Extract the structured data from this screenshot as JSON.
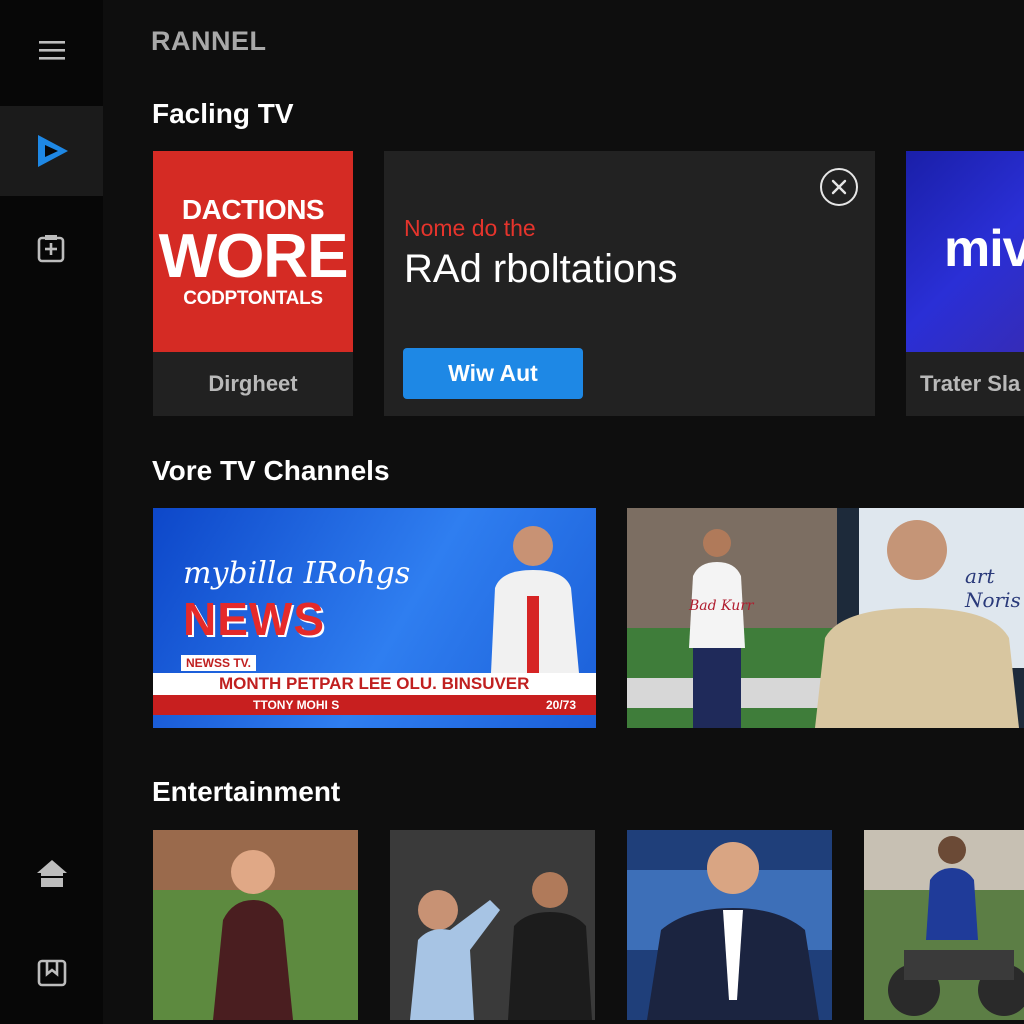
{
  "app": {
    "brand": "RANNEL"
  },
  "sidebar": {
    "items": [
      {
        "id": "menu",
        "icon": "menu-icon"
      },
      {
        "id": "play",
        "icon": "play-icon",
        "active": true
      },
      {
        "id": "add",
        "icon": "add-box-icon"
      },
      {
        "id": "home",
        "icon": "home-icon"
      },
      {
        "id": "downloads",
        "icon": "download-box-icon"
      }
    ]
  },
  "sections": {
    "featured": {
      "title": "Facling TV"
    },
    "channels": {
      "title": "Vore TV Channels"
    },
    "entertainment": {
      "title": "Entertainment"
    }
  },
  "featured": {
    "tile1": {
      "art_line1": "DACTIONS",
      "art_line2": "WORE",
      "art_line3": "CODPTONTALS",
      "caption": "Dirgheet"
    },
    "promo": {
      "kicker": "Nome do the",
      "headline": "RAd rboltations",
      "cta_label": "Wiw Aut",
      "close_icon": "close-icon"
    },
    "tile3": {
      "art_text": "miv",
      "caption": "Trater Sla"
    }
  },
  "channels": {
    "news": {
      "script_text": "mybilla IRohgs",
      "big_text": "NEWS",
      "tag": "NEWSS TV.",
      "ticker": "MONTH PETPAR LEE OLU. BINSUVER",
      "ticker_left": "TTONY MOHI S",
      "ticker_right": "20/73"
    },
    "sports": {
      "jersey_text": "Bad Kurr"
    },
    "studio": {
      "screen_text": "art Noris"
    }
  },
  "colors": {
    "accent": "#1e88e5",
    "kicker_red": "#e5342c",
    "news_red": "#e52a2a"
  }
}
